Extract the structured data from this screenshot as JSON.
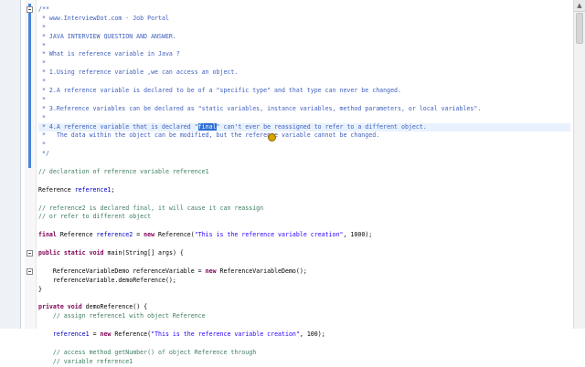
{
  "editor": {
    "lines": [
      [
        {
          "t": "/**",
          "c": "jd"
        }
      ],
      [
        {
          "t": " * www.InterviewDot.com - Job Portal",
          "c": "jd"
        }
      ],
      [
        {
          "t": " *",
          "c": "jd"
        }
      ],
      [
        {
          "t": " * JAVA INTERVIEW QUESTION AND ANSWER.",
          "c": "jd"
        }
      ],
      [
        {
          "t": " *",
          "c": "jd"
        }
      ],
      [
        {
          "t": " * What is reference variable in Java ?",
          "c": "jd"
        }
      ],
      [
        {
          "t": " *",
          "c": "jd"
        }
      ],
      [
        {
          "t": " * 1.Using reference variable ,we can access an object.",
          "c": "jd"
        }
      ],
      [
        {
          "t": " *",
          "c": "jd"
        }
      ],
      [
        {
          "t": " * 2.A reference variable is declared to be of a \"specific type\" and that type can never be changed.",
          "c": "jd"
        }
      ],
      [
        {
          "t": " *",
          "c": "jd"
        }
      ],
      [
        {
          "t": " * 3.Reference variables can be declared as \"static variables, instance variables, method parameters, or local variables\".",
          "c": "jd"
        }
      ],
      [
        {
          "t": " *",
          "c": "jd"
        }
      ],
      [
        {
          "t": " * 4.A reference variable that is declared \"",
          "c": "jd"
        },
        {
          "t": "final",
          "c": "sel"
        },
        {
          "t": "\" can't ever be reassigned to refer to a different object.",
          "c": "jd"
        }
      ],
      [
        {
          "t": " *   The data within the object can be modified, but the reference variable cannot be changed.",
          "c": "jd"
        }
      ],
      [
        {
          "t": " *",
          "c": "jd"
        }
      ],
      [
        {
          "t": " */",
          "c": "jd"
        }
      ],
      [],
      [
        {
          "t": "// declaration of reference variable reference1",
          "c": "cm"
        }
      ],
      [],
      [
        {
          "t": "Reference "
        },
        {
          "t": "reference1",
          "c": "fld"
        },
        {
          "t": ";"
        }
      ],
      [],
      [
        {
          "t": "// reference2 is declared final, it will cause it can reassign",
          "c": "cm"
        }
      ],
      [
        {
          "t": "// or refer to different object",
          "c": "cm"
        }
      ],
      [],
      [
        {
          "t": "final",
          "c": "kw"
        },
        {
          "t": " Reference "
        },
        {
          "t": "reference2",
          "c": "fld"
        },
        {
          "t": " = "
        },
        {
          "t": "new",
          "c": "kw"
        },
        {
          "t": " Reference("
        },
        {
          "t": "\"This is the reference variable creation\"",
          "c": "st"
        },
        {
          "t": ", 1000);"
        }
      ],
      [],
      [
        {
          "t": "public",
          "c": "kw"
        },
        {
          "t": " "
        },
        {
          "t": "static",
          "c": "kw"
        },
        {
          "t": " "
        },
        {
          "t": "void",
          "c": "kw"
        },
        {
          "t": " main(String[] args) {"
        }
      ],
      [],
      [
        {
          "t": "    ReferenceVariableDemo referenceVariable = "
        },
        {
          "t": "new",
          "c": "kw"
        },
        {
          "t": " ReferenceVariableDemo();"
        }
      ],
      [
        {
          "t": "    referenceVariable.demoReference();"
        }
      ],
      [
        {
          "t": "}"
        }
      ],
      [],
      [
        {
          "t": "private",
          "c": "kw"
        },
        {
          "t": " "
        },
        {
          "t": "void",
          "c": "kw"
        },
        {
          "t": " demoReference() {"
        }
      ],
      [
        {
          "t": "    // assign reference1 with object Reference",
          "c": "cm"
        }
      ],
      [],
      [
        {
          "t": "    "
        },
        {
          "t": "reference1",
          "c": "fld"
        },
        {
          "t": " = "
        },
        {
          "t": "new",
          "c": "kw"
        },
        {
          "t": " Reference("
        },
        {
          "t": "\"This is the reference variable creation\"",
          "c": "st"
        },
        {
          "t": ", 100);"
        }
      ],
      [],
      [
        {
          "t": "    // access method getNumber() of object Reference through",
          "c": "cm"
        }
      ],
      [
        {
          "t": "    // variable reference1",
          "c": "cm"
        }
      ]
    ],
    "current_line": 13,
    "selected_text": "final",
    "scroll_up_icon": "chevron-up-icon",
    "colors": {
      "comment": "#3f7f5f",
      "javadoc": "#3f5fbf",
      "keyword": "#7f0055",
      "string": "#2a00ff",
      "field": "#0000c0",
      "selection": "#2e6fd3",
      "current_line": "#e8f2fe"
    }
  }
}
